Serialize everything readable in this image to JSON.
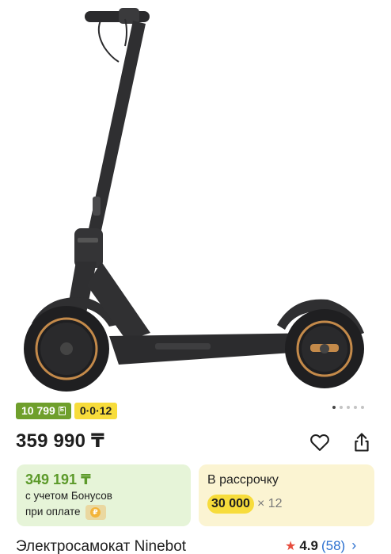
{
  "badges": {
    "bonus": "10 799",
    "bonus_icon": "Б",
    "installment": "0·0·12"
  },
  "carousel": {
    "dots": 5,
    "active_index": 0
  },
  "price": "359 990 ₸",
  "bonus_card": {
    "price": "349 191 ₸",
    "line1": "с учетом Бонусов",
    "line2": "при оплате",
    "icon": "pay-icon"
  },
  "installment_card": {
    "title": "В рассрочку",
    "amount": "30 000",
    "months": "× 12"
  },
  "product": {
    "title": "Электросамокат Ninebot"
  },
  "rating": {
    "value": "4.9",
    "count": "(58)"
  },
  "icons": {
    "favorite": "heart-icon",
    "share": "share-icon",
    "star": "star-icon",
    "chevron": "chevron-right-icon"
  },
  "colors": {
    "bonus_green": "#6f9f2c",
    "installment_yellow": "#f7dc3b",
    "link_blue": "#2a6fcf",
    "star_red": "#e64b3c"
  }
}
